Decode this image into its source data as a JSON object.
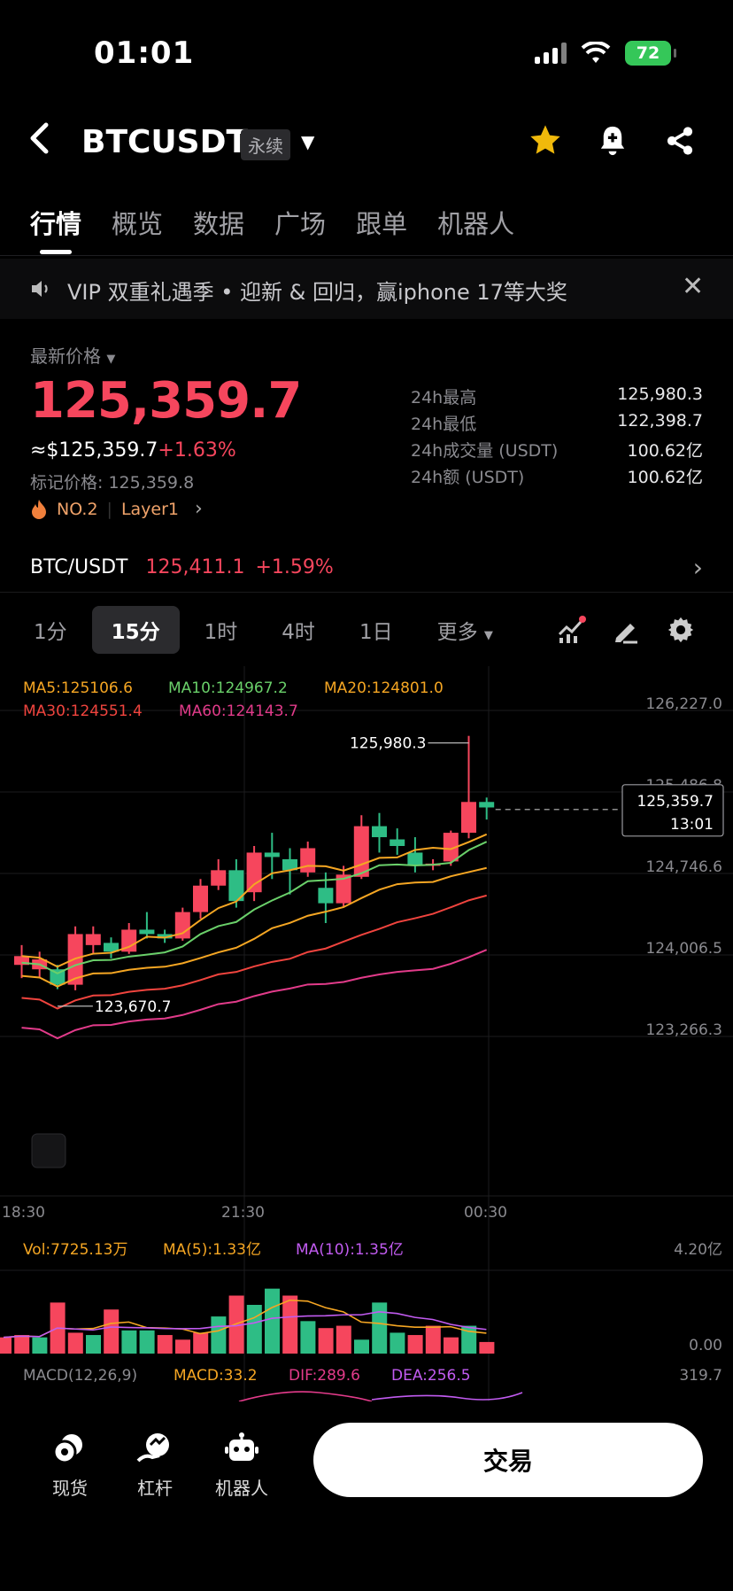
{
  "status_bar": {
    "time": "01:01",
    "battery": "72"
  },
  "header": {
    "title": "BTCUSDT",
    "badge": "永续"
  },
  "tabs": [
    {
      "label": "行情",
      "active": true
    },
    {
      "label": "概览"
    },
    {
      "label": "数据"
    },
    {
      "label": "广场"
    },
    {
      "label": "跟单"
    },
    {
      "label": "机器人"
    }
  ],
  "announcement": {
    "text": "VIP 双重礼遇季 • 迎新 & 回归，赢iphone 17等大奖"
  },
  "price": {
    "label": "最新价格",
    "last": "125,359.7",
    "usd": "≈$125,359.7",
    "change": "+1.63%",
    "mark_label": "标记价格:",
    "mark_value": "125,359.8",
    "rank": "NO.2",
    "sector": "Layer1"
  },
  "stats": [
    {
      "k": "24h最高",
      "v": "125,980.3"
    },
    {
      "k": "24h最低",
      "v": "122,398.7"
    },
    {
      "k": "24h成交量 (USDT)",
      "v": "100.62亿"
    },
    {
      "k": "24h额 (USDT)",
      "v": "100.62亿"
    }
  ],
  "spot": {
    "pair": "BTC/USDT",
    "price": "125,411.1",
    "change": "+1.59%"
  },
  "intervals": [
    {
      "label": "1分"
    },
    {
      "label": "15分",
      "active": true
    },
    {
      "label": "1时"
    },
    {
      "label": "4时"
    },
    {
      "label": "1日"
    },
    {
      "label": "更多"
    }
  ],
  "chart_data": {
    "type": "candlestick",
    "interval": "15分",
    "ma_legend": {
      "ma5": "MA5:125106.6",
      "ma10": "MA10:124967.2",
      "ma20": "MA20:124801.0",
      "ma30": "MA30:124551.4",
      "ma60": "MA60:124143.7"
    },
    "y_ticks": [
      "126,227.0",
      "125,486.8",
      "124,746.6",
      "124,006.5",
      "123,266.3"
    ],
    "x_ticks": [
      "18:30",
      "21:30",
      "00:30"
    ],
    "high_label": "125,980.3",
    "low_label": "123,670.7",
    "current_price": "125,359.7",
    "countdown": "13:01",
    "ylim": [
      123266.3,
      126227.0
    ],
    "candles": [
      {
        "o": 123900,
        "c": 123980,
        "h": 124080,
        "l": 123780
      },
      {
        "o": 123860,
        "c": 123950,
        "h": 124020,
        "l": 123780
      },
      {
        "o": 123860,
        "c": 123720,
        "h": 123900,
        "l": 123680
      },
      {
        "o": 123720,
        "c": 124180,
        "h": 124250,
        "l": 123670
      },
      {
        "o": 124080,
        "c": 124180,
        "h": 124250,
        "l": 124000
      },
      {
        "o": 124100,
        "c": 124020,
        "h": 124150,
        "l": 123960
      },
      {
        "o": 124020,
        "c": 124220,
        "h": 124280,
        "l": 124000
      },
      {
        "o": 124220,
        "c": 124180,
        "h": 124380,
        "l": 124140
      },
      {
        "o": 124180,
        "c": 124140,
        "h": 124220,
        "l": 124100
      },
      {
        "o": 124140,
        "c": 124380,
        "h": 124420,
        "l": 124120
      },
      {
        "o": 124380,
        "c": 124620,
        "h": 124680,
        "l": 124320
      },
      {
        "o": 124620,
        "c": 124760,
        "h": 124860,
        "l": 124580
      },
      {
        "o": 124760,
        "c": 124480,
        "h": 124860,
        "l": 124420
      },
      {
        "o": 124560,
        "c": 124920,
        "h": 124980,
        "l": 124480
      },
      {
        "o": 124920,
        "c": 124880,
        "h": 125100,
        "l": 124680
      },
      {
        "o": 124860,
        "c": 124760,
        "h": 124960,
        "l": 124540
      },
      {
        "o": 124740,
        "c": 124960,
        "h": 125020,
        "l": 124700
      },
      {
        "o": 124600,
        "c": 124460,
        "h": 124740,
        "l": 124280
      },
      {
        "o": 124460,
        "c": 124720,
        "h": 124800,
        "l": 124420
      },
      {
        "o": 124700,
        "c": 125160,
        "h": 125260,
        "l": 124680
      },
      {
        "o": 125160,
        "c": 125060,
        "h": 125280,
        "l": 124920
      },
      {
        "o": 125040,
        "c": 124980,
        "h": 125140,
        "l": 124900
      },
      {
        "o": 124920,
        "c": 124800,
        "h": 125060,
        "l": 124740
      },
      {
        "o": 124800,
        "c": 124820,
        "h": 124860,
        "l": 124760
      },
      {
        "o": 124840,
        "c": 125100,
        "h": 125120,
        "l": 124800
      },
      {
        "o": 125100,
        "c": 125380,
        "h": 125980,
        "l": 125050
      },
      {
        "o": 125380,
        "c": 125330,
        "h": 125420,
        "l": 125220
      }
    ],
    "volume": {
      "legend": {
        "vol": "Vol:7725.13万",
        "ma5": "MA(5):1.33亿",
        "ma10": "MA(10):1.35亿"
      },
      "y_ticks": [
        "4.20亿",
        "0.00"
      ],
      "values": [
        0.7,
        0.8,
        0.7,
        2.2,
        0.9,
        0.8,
        1.9,
        1.0,
        1.0,
        0.8,
        0.6,
        0.9,
        1.6,
        2.5,
        2.1,
        2.8,
        2.5,
        1.4,
        1.1,
        1.2,
        0.6,
        2.2,
        0.9,
        0.8,
        1.2,
        0.7,
        1.2,
        0.5
      ]
    },
    "macd": {
      "legend": {
        "title": "MACD(12,26,9)",
        "macd": "MACD:33.2",
        "dif": "DIF:289.6",
        "dea": "DEA:256.5"
      },
      "y_tick": "319.7"
    }
  },
  "bottom_nav": [
    {
      "label": "现货"
    },
    {
      "label": "杠杆"
    },
    {
      "label": "机器人"
    }
  ],
  "trade_button": "交易",
  "colors": {
    "up": "#f6465d",
    "down": "#2ebd85",
    "ma5": "#f5a623",
    "ma10": "#6ad06a",
    "ma20": "#f5a623",
    "ma30": "#f0443e",
    "ma60": "#e23b8a"
  }
}
